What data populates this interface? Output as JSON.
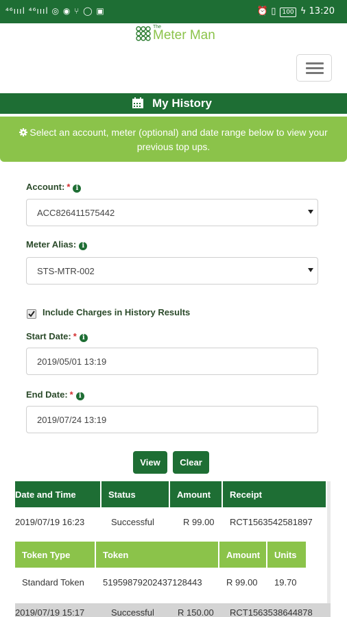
{
  "status_bar": {
    "left_indicators": "⁴⁶ıııl ⁴⁶ıııl ◎ ◉ ⑂ ◯ ▣",
    "battery": "100",
    "time": "13:20"
  },
  "brand": {
    "prefix": "The",
    "name": "Meter Man"
  },
  "page_title": "My History",
  "banner_text": "Select an account, meter (optional) and date range below to view your previous top ups.",
  "form": {
    "account": {
      "label": "Account:",
      "required": "*",
      "value": "ACC826411575442"
    },
    "meter_alias": {
      "label": "Meter Alias:",
      "value": "STS-MTR-002"
    },
    "include_charges": {
      "label": "Include Charges in History Results",
      "checked": true
    },
    "start_date": {
      "label": "Start Date:",
      "required": "*",
      "value": "2019/05/01 13:19"
    },
    "end_date": {
      "label": "End Date:",
      "required": "*",
      "value": "2019/07/24 13:19"
    }
  },
  "buttons": {
    "view": "View",
    "clear": "Clear"
  },
  "history_table": {
    "headers": [
      "Date and Time",
      "Status",
      "Amount",
      "Receipt"
    ],
    "rows": [
      [
        "2019/07/19 16:23",
        "Successful",
        "R 99.00",
        "RCT1563542581897"
      ],
      [
        "2019/07/19 15:17",
        "Successful",
        "R 150.00",
        "RCT1563538644878"
      ]
    ]
  },
  "token_table": {
    "headers": [
      "Token Type",
      "Token",
      "Amount",
      "Units"
    ],
    "rows": [
      [
        "Standard Token",
        "51959879202437128443",
        "R 99.00",
        "19.70"
      ]
    ]
  },
  "colors": {
    "primary": "#1e6e34",
    "accent": "#8bc34a",
    "required": "#d32f2f"
  }
}
